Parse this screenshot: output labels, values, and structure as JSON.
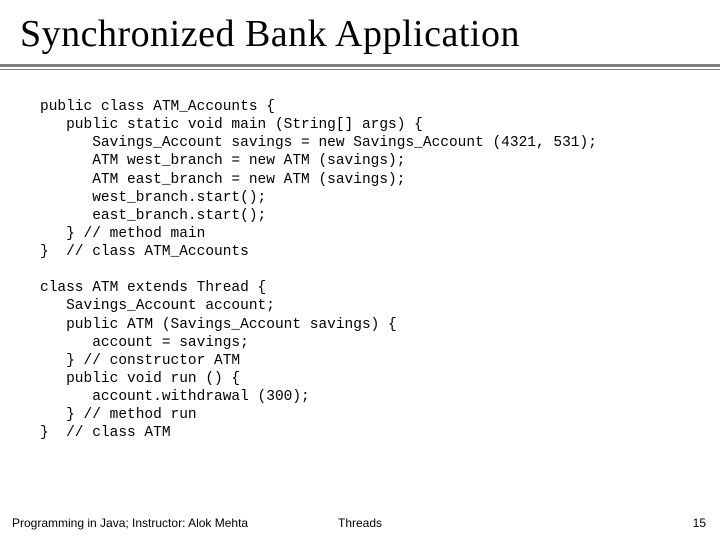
{
  "title": "Synchronized Bank Application",
  "code_block1": "public class ATM_Accounts {\n   public static void main (String[] args) {\n      Savings_Account savings = new Savings_Account (4321, 531);\n      ATM west_branch = new ATM (savings);\n      ATM east_branch = new ATM (savings);\n      west_branch.start();\n      east_branch.start();\n   } // method main\n}  // class ATM_Accounts",
  "code_block2": "class ATM extends Thread {\n   Savings_Account account;\n   public ATM (Savings_Account savings) {\n      account = savings;\n   } // constructor ATM\n   public void run () {\n      account.withdrawal (300);\n   } // method run\n}  // class ATM",
  "footer": {
    "left": "Programming in Java; Instructor: Alok Mehta",
    "center": "Threads",
    "page": "15"
  }
}
